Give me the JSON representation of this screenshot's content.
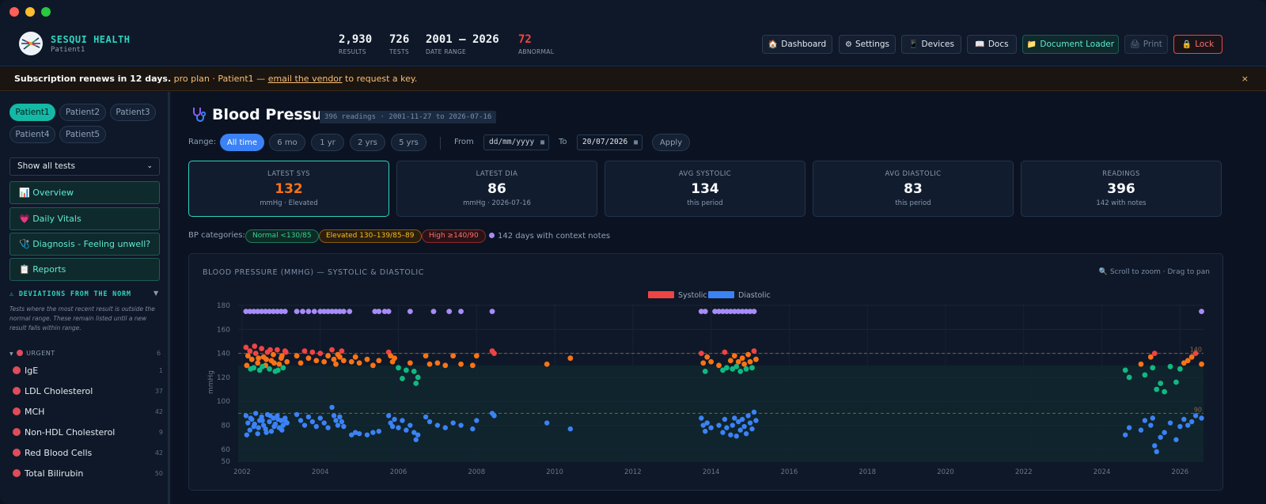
{
  "window": {
    "controls": {
      "close": "#ff5f57",
      "minimize": "#febc2e",
      "maximize": "#28c840"
    }
  },
  "brand": {
    "name": "SESQUI HEALTH",
    "patient": "Patient1"
  },
  "stats": [
    {
      "value": "2,930",
      "label": "RESULTS",
      "color": "#f1f5f9"
    },
    {
      "value": "726",
      "label": "TESTS",
      "color": "#f1f5f9"
    },
    {
      "value": "2001 – 2026",
      "label": "DATE RANGE",
      "color": "#f1f5f9"
    },
    {
      "value": "72",
      "label": "ABNORMAL",
      "color": "#ef4444"
    }
  ],
  "header_buttons": [
    {
      "label": "Dashboard",
      "icon": "house-icon"
    },
    {
      "label": "Settings",
      "icon": "gear-icon"
    },
    {
      "label": "Devices",
      "icon": "device-icon"
    },
    {
      "label": "Docs",
      "icon": "book-icon"
    },
    {
      "label": "Document Loader",
      "icon": "folder-icon"
    },
    {
      "label": "Print",
      "icon": "printer-icon"
    },
    {
      "label": "Lock",
      "icon": "lock-icon"
    }
  ],
  "banner": {
    "bold": "Subscription renews in 12 days.",
    "mid": " pro plan · Patient1 — ",
    "link": "email the vendor",
    "end": " to request a key.",
    "close": "×"
  },
  "sidebar": {
    "patients": [
      "Patient1",
      "Patient2",
      "Patient3",
      "Patient4",
      "Patient5"
    ],
    "active_patient": "Patient1",
    "test_filter": "Show all tests",
    "nav": [
      {
        "label": "Overview",
        "icon": "chart-icon",
        "glyph": "📊"
      },
      {
        "label": "Daily Vitals",
        "icon": "heart-icon",
        "glyph": "💗"
      },
      {
        "label": "Diagnosis - Feeling unwell?",
        "icon": "stethoscope-icon",
        "glyph": "🩺"
      },
      {
        "label": "Reports",
        "icon": "clipboard-icon",
        "glyph": "📋"
      }
    ],
    "deviations": {
      "title": "⚠ DEVIATIONS FROM THE NORM",
      "note": "Tests where the most recent result is outside the normal range. These remain listed until a new result falls within range.",
      "group": "URGENT",
      "group_count": "6",
      "items": [
        {
          "name": "IgE",
          "count": "1"
        },
        {
          "name": "LDL Cholesterol",
          "count": "37"
        },
        {
          "name": "MCH",
          "count": "42"
        },
        {
          "name": "Non-HDL Cholesterol",
          "count": "9"
        },
        {
          "name": "Red Blood Cells",
          "count": "42"
        },
        {
          "name": "Total Bilirubin",
          "count": "50"
        }
      ]
    }
  },
  "page": {
    "title": "Blood Pressure",
    "title_icon": "stethoscope-icon",
    "tag": "396 readings · 2001-11-27 to 2026-07-16",
    "range_label": "Range:",
    "ranges": [
      "All time",
      "6 mo",
      "1 yr",
      "2 yrs",
      "5 yrs"
    ],
    "active_range": "All time",
    "from_label": "From",
    "from_placeholder": "dd/mm/yyyy",
    "to_label": "To",
    "to_value": "20/07/2026",
    "apply": "Apply"
  },
  "cards": [
    {
      "label": "LATEST SYS",
      "value": "132",
      "sub": "mmHg · Elevated",
      "color": "#f97316",
      "highlight": true
    },
    {
      "label": "LATEST DIA",
      "value": "86",
      "sub": "mmHg · 2026-07-16",
      "color": "#f8fafc",
      "highlight": false
    },
    {
      "label": "AVG SYSTOLIC",
      "value": "134",
      "sub": "this period",
      "color": "#f8fafc",
      "highlight": false
    },
    {
      "label": "AVG DIASTOLIC",
      "value": "83",
      "sub": "this period",
      "color": "#f8fafc",
      "highlight": false
    },
    {
      "label": "READINGS",
      "value": "396",
      "sub": "142 with notes",
      "color": "#f8fafc",
      "highlight": false
    }
  ],
  "categories": {
    "label": "BP categories:",
    "items": [
      {
        "label": "Normal <130/85",
        "color": "#2dd4bf"
      },
      {
        "label": "Elevated 130–139/85–89",
        "color": "#f59e0b"
      },
      {
        "label": "High ≥140/90",
        "color": "#ef4444"
      }
    ],
    "notes": "142 days with context notes"
  },
  "chart": {
    "title": "BLOOD PRESSURE (MMHG) — SYSTOLIC & DIASTOLIC",
    "hint": "🔍 Scroll to zoom · Drag to pan",
    "legend": [
      {
        "name": "Systolic",
        "color": "#ef4444"
      },
      {
        "name": "Diastolic",
        "color": "#3b82f6"
      }
    ],
    "ref_labels": {
      "sys": "140",
      "dia": "90"
    }
  },
  "chart_data": {
    "type": "scatter",
    "title": "BLOOD PRESSURE (MMHG) — SYSTOLIC & DIASTOLIC",
    "ylabel": "mmHg",
    "xlabel": "",
    "xlim": [
      2001.9,
      2026.6
    ],
    "ylim": [
      50,
      182
    ],
    "yticks": [
      50,
      60,
      80,
      100,
      120,
      140,
      160,
      180
    ],
    "xticks": [
      2002,
      2004,
      2006,
      2008,
      2010,
      2012,
      2014,
      2016,
      2018,
      2020,
      2022,
      2024,
      2026
    ],
    "reference_lines": [
      {
        "y": 140,
        "label": "140"
      },
      {
        "y": 90,
        "label": "90"
      }
    ],
    "normal_band": [
      50,
      130
    ],
    "note_marker_y": 175,
    "colors": {
      "high": "#ef4444",
      "elevated": "#f97316",
      "normal": "#10b981",
      "diastolic": "#3b82f6",
      "note": "#a78bfa"
    },
    "systolic": [
      [
        2002.1,
        145
      ],
      [
        2002.15,
        138
      ],
      [
        2002.2,
        142
      ],
      [
        2002.25,
        135
      ],
      [
        2002.3,
        128
      ],
      [
        2002.35,
        140
      ],
      [
        2002.4,
        132
      ],
      [
        2002.45,
        126
      ],
      [
        2002.5,
        144
      ],
      [
        2002.55,
        137
      ],
      [
        2002.6,
        130
      ],
      [
        2002.65,
        141
      ],
      [
        2002.7,
        127
      ],
      [
        2002.75,
        134
      ],
      [
        2002.8,
        139
      ],
      [
        2002.85,
        125
      ],
      [
        2002.9,
        143
      ],
      [
        2002.95,
        131
      ],
      [
        2003.0,
        136
      ],
      [
        2003.05,
        128
      ],
      [
        2003.1,
        142
      ],
      [
        2003.15,
        133
      ],
      [
        2002.12,
        130
      ],
      [
        2002.22,
        127
      ],
      [
        2002.32,
        146
      ],
      [
        2002.42,
        136
      ],
      [
        2002.52,
        129
      ],
      [
        2002.62,
        135
      ],
      [
        2002.72,
        143
      ],
      [
        2002.82,
        132
      ],
      [
        2002.92,
        126
      ],
      [
        2003.02,
        138
      ],
      [
        2003.12,
        141
      ],
      [
        2003.4,
        138
      ],
      [
        2003.5,
        132
      ],
      [
        2003.6,
        142
      ],
      [
        2003.7,
        136
      ],
      [
        2003.8,
        141
      ],
      [
        2003.9,
        134
      ],
      [
        2004.0,
        140
      ],
      [
        2004.1,
        133
      ],
      [
        2004.2,
        138
      ],
      [
        2004.3,
        143
      ],
      [
        2004.35,
        135
      ],
      [
        2004.4,
        131
      ],
      [
        2004.45,
        139
      ],
      [
        2004.5,
        137
      ],
      [
        2004.55,
        142
      ],
      [
        2004.6,
        134
      ],
      [
        2004.8,
        133
      ],
      [
        2004.9,
        137
      ],
      [
        2005.0,
        132
      ],
      [
        2005.2,
        135
      ],
      [
        2005.35,
        130
      ],
      [
        2005.5,
        134
      ],
      [
        2005.75,
        141
      ],
      [
        2005.8,
        138
      ],
      [
        2005.85,
        133
      ],
      [
        2005.9,
        136
      ],
      [
        2006.0,
        128
      ],
      [
        2006.1,
        119
      ],
      [
        2006.2,
        126
      ],
      [
        2006.3,
        132
      ],
      [
        2006.4,
        125
      ],
      [
        2006.45,
        115
      ],
      [
        2006.5,
        120
      ],
      [
        2006.7,
        138
      ],
      [
        2006.8,
        131
      ],
      [
        2007.0,
        132
      ],
      [
        2007.2,
        130
      ],
      [
        2007.4,
        138
      ],
      [
        2007.6,
        131
      ],
      [
        2007.9,
        130
      ],
      [
        2008.0,
        138
      ],
      [
        2008.4,
        142
      ],
      [
        2008.45,
        140
      ],
      [
        2009.8,
        131
      ],
      [
        2010.4,
        136
      ],
      [
        2013.75,
        140
      ],
      [
        2013.8,
        132
      ],
      [
        2013.85,
        125
      ],
      [
        2013.9,
        137
      ],
      [
        2014.0,
        133
      ],
      [
        2014.2,
        130
      ],
      [
        2014.3,
        126
      ],
      [
        2014.35,
        141
      ],
      [
        2014.4,
        128
      ],
      [
        2014.5,
        134
      ],
      [
        2014.55,
        127
      ],
      [
        2014.6,
        138
      ],
      [
        2014.65,
        129
      ],
      [
        2014.7,
        133
      ],
      [
        2014.75,
        125
      ],
      [
        2014.8,
        136
      ],
      [
        2014.85,
        131
      ],
      [
        2014.9,
        127
      ],
      [
        2014.95,
        139
      ],
      [
        2015.0,
        133
      ],
      [
        2015.05,
        128
      ],
      [
        2015.1,
        142
      ],
      [
        2015.15,
        135
      ],
      [
        2024.6,
        126
      ],
      [
        2024.7,
        120
      ],
      [
        2025.0,
        131
      ],
      [
        2025.1,
        122
      ],
      [
        2025.25,
        137
      ],
      [
        2025.3,
        128
      ],
      [
        2025.35,
        140
      ],
      [
        2025.4,
        110
      ],
      [
        2025.5,
        115
      ],
      [
        2025.6,
        108
      ],
      [
        2025.75,
        129
      ],
      [
        2025.9,
        116
      ],
      [
        2026.0,
        127
      ],
      [
        2026.1,
        132
      ],
      [
        2026.2,
        134
      ],
      [
        2026.3,
        137
      ],
      [
        2026.4,
        140
      ],
      [
        2026.55,
        131
      ]
    ],
    "diastolic": [
      [
        2002.1,
        88
      ],
      [
        2002.15,
        82
      ],
      [
        2002.2,
        76
      ],
      [
        2002.25,
        85
      ],
      [
        2002.3,
        79
      ],
      [
        2002.35,
        90
      ],
      [
        2002.4,
        73
      ],
      [
        2002.45,
        84
      ],
      [
        2002.5,
        87
      ],
      [
        2002.55,
        80
      ],
      [
        2002.6,
        77
      ],
      [
        2002.65,
        89
      ],
      [
        2002.7,
        83
      ],
      [
        2002.75,
        75
      ],
      [
        2002.8,
        86
      ],
      [
        2002.85,
        81
      ],
      [
        2002.9,
        88
      ],
      [
        2002.95,
        78
      ],
      [
        2003.0,
        84
      ],
      [
        2003.05,
        80
      ],
      [
        2003.1,
        86
      ],
      [
        2003.15,
        82
      ],
      [
        2002.12,
        72
      ],
      [
        2002.22,
        86
      ],
      [
        2002.32,
        81
      ],
      [
        2002.42,
        78
      ],
      [
        2002.52,
        84
      ],
      [
        2002.62,
        74
      ],
      [
        2002.72,
        88
      ],
      [
        2002.82,
        79
      ],
      [
        2002.92,
        85
      ],
      [
        2003.02,
        76
      ],
      [
        2003.12,
        83
      ],
      [
        2003.4,
        89
      ],
      [
        2003.5,
        84
      ],
      [
        2003.6,
        80
      ],
      [
        2003.7,
        87
      ],
      [
        2003.8,
        83
      ],
      [
        2003.9,
        79
      ],
      [
        2004.0,
        86
      ],
      [
        2004.1,
        82
      ],
      [
        2004.2,
        78
      ],
      [
        2004.3,
        95
      ],
      [
        2004.35,
        88
      ],
      [
        2004.4,
        84
      ],
      [
        2004.45,
        80
      ],
      [
        2004.5,
        87
      ],
      [
        2004.55,
        83
      ],
      [
        2004.6,
        79
      ],
      [
        2004.8,
        72
      ],
      [
        2004.9,
        74
      ],
      [
        2005.0,
        73
      ],
      [
        2005.2,
        72
      ],
      [
        2005.35,
        74
      ],
      [
        2005.5,
        75
      ],
      [
        2005.75,
        88
      ],
      [
        2005.8,
        82
      ],
      [
        2005.85,
        79
      ],
      [
        2005.9,
        85
      ],
      [
        2006.0,
        78
      ],
      [
        2006.1,
        84
      ],
      [
        2006.2,
        76
      ],
      [
        2006.3,
        80
      ],
      [
        2006.4,
        74
      ],
      [
        2006.45,
        68
      ],
      [
        2006.5,
        72
      ],
      [
        2006.7,
        87
      ],
      [
        2006.8,
        83
      ],
      [
        2007.0,
        80
      ],
      [
        2007.2,
        78
      ],
      [
        2007.4,
        82
      ],
      [
        2007.6,
        80
      ],
      [
        2007.9,
        77
      ],
      [
        2008.0,
        84
      ],
      [
        2008.4,
        90
      ],
      [
        2008.45,
        88
      ],
      [
        2009.8,
        82
      ],
      [
        2010.4,
        77
      ],
      [
        2013.75,
        86
      ],
      [
        2013.8,
        80
      ],
      [
        2013.85,
        75
      ],
      [
        2013.9,
        82
      ],
      [
        2014.0,
        78
      ],
      [
        2014.2,
        80
      ],
      [
        2014.3,
        74
      ],
      [
        2014.35,
        85
      ],
      [
        2014.4,
        78
      ],
      [
        2014.5,
        72
      ],
      [
        2014.55,
        80
      ],
      [
        2014.6,
        86
      ],
      [
        2014.65,
        71
      ],
      [
        2014.7,
        83
      ],
      [
        2014.75,
        76
      ],
      [
        2014.8,
        85
      ],
      [
        2014.85,
        79
      ],
      [
        2014.9,
        73
      ],
      [
        2014.95,
        88
      ],
      [
        2015.0,
        82
      ],
      [
        2015.05,
        77
      ],
      [
        2015.1,
        91
      ],
      [
        2015.15,
        84
      ],
      [
        2024.6,
        72
      ],
      [
        2024.7,
        78
      ],
      [
        2025.0,
        76
      ],
      [
        2025.1,
        84
      ],
      [
        2025.25,
        80
      ],
      [
        2025.3,
        86
      ],
      [
        2025.35,
        63
      ],
      [
        2025.4,
        58
      ],
      [
        2025.5,
        70
      ],
      [
        2025.6,
        74
      ],
      [
        2025.75,
        82
      ],
      [
        2025.9,
        68
      ],
      [
        2026.0,
        79
      ],
      [
        2026.1,
        85
      ],
      [
        2026.2,
        80
      ],
      [
        2026.3,
        83
      ],
      [
        2026.4,
        88
      ],
      [
        2026.55,
        86
      ]
    ],
    "notes_x": [
      2002.1,
      2002.2,
      2002.3,
      2002.4,
      2002.5,
      2002.6,
      2002.7,
      2002.8,
      2002.9,
      2003.0,
      2003.1,
      2003.4,
      2003.55,
      2003.7,
      2003.85,
      2004.0,
      2004.1,
      2004.2,
      2004.3,
      2004.4,
      2004.5,
      2004.6,
      2004.75,
      2005.4,
      2005.5,
      2005.65,
      2005.75,
      2006.3,
      2006.9,
      2007.3,
      2007.6,
      2008.4,
      2013.75,
      2013.85,
      2014.1,
      2014.2,
      2014.3,
      2014.4,
      2014.5,
      2014.6,
      2014.7,
      2014.8,
      2014.9,
      2015.0,
      2015.1,
      2026.55
    ]
  }
}
